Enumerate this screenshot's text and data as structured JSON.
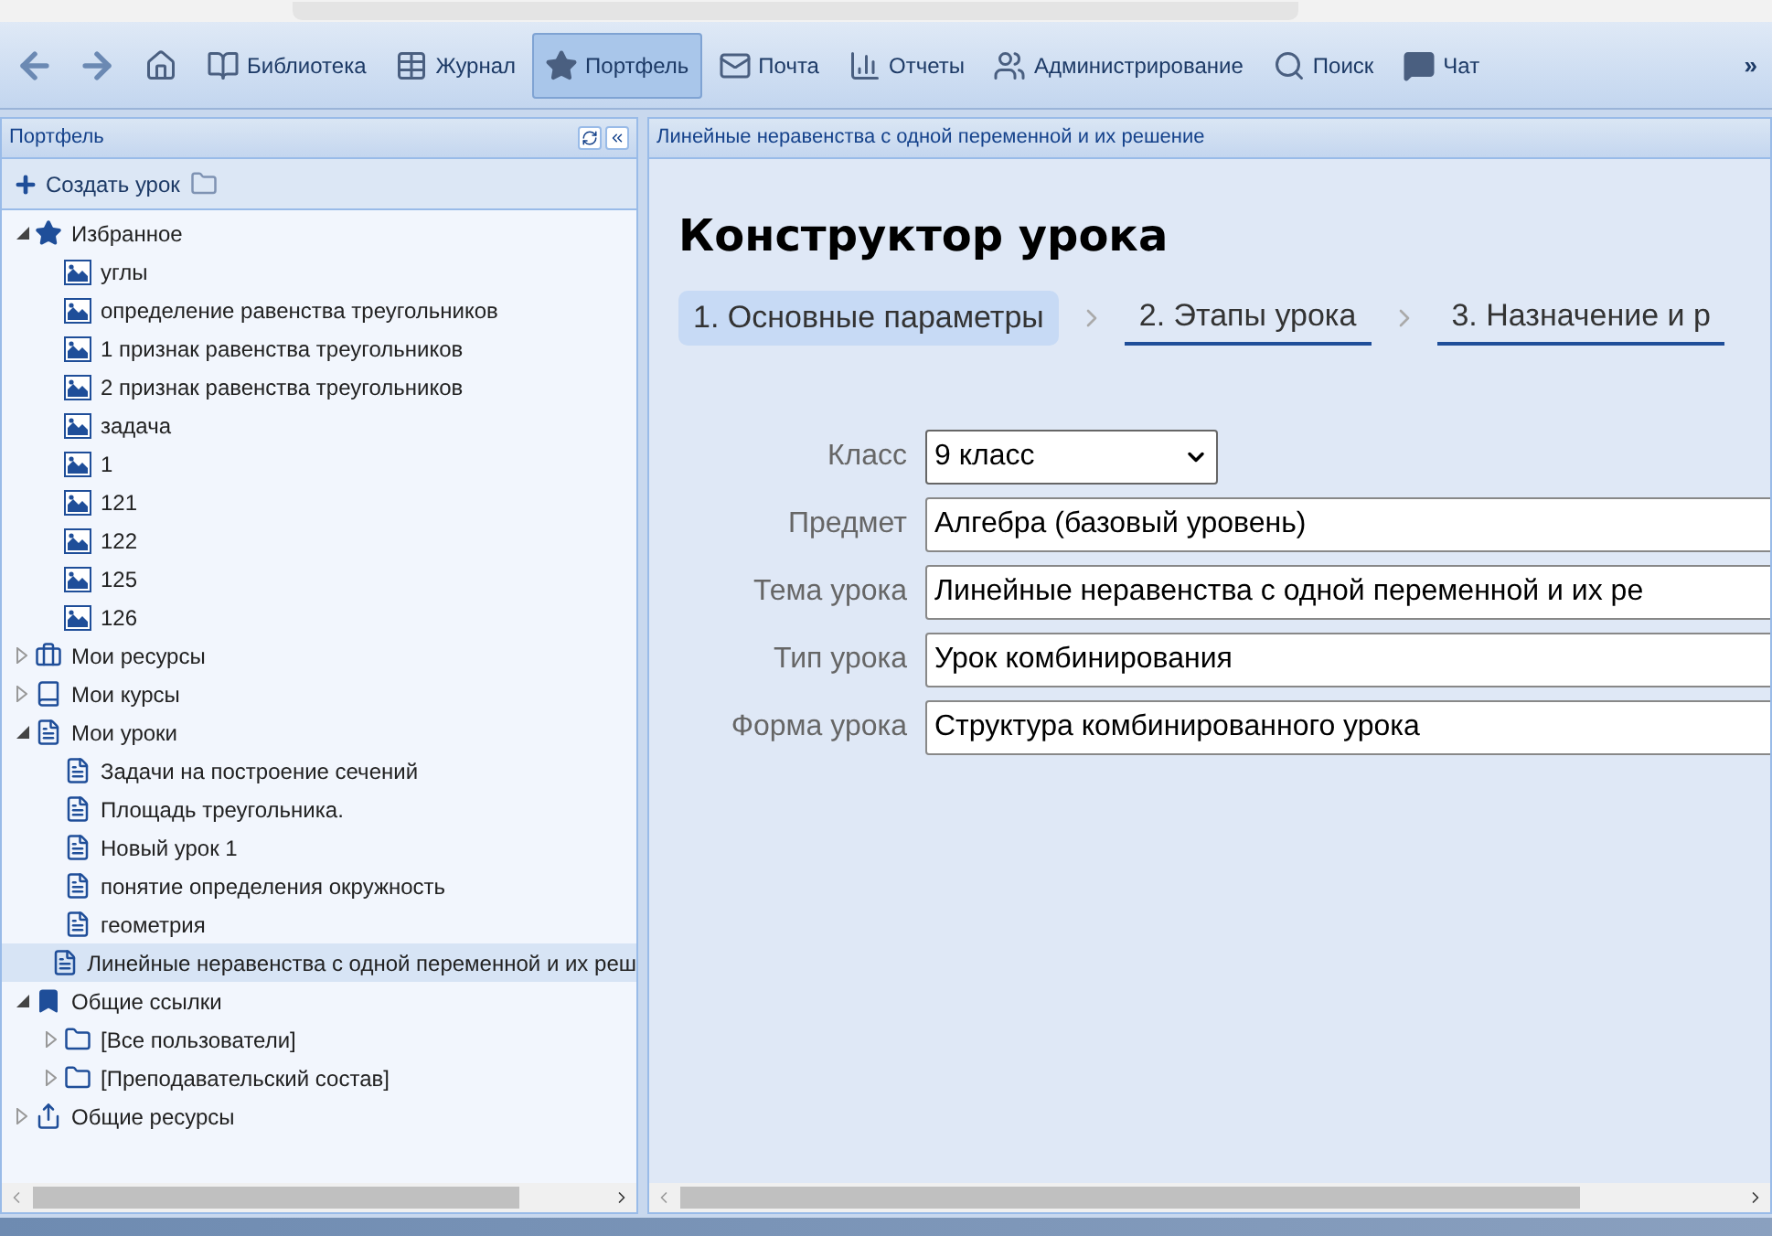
{
  "toolbar": {
    "items": [
      {
        "kind": "home",
        "selected": false
      },
      {
        "kind": "book",
        "label": "Библиотека",
        "selected": false
      },
      {
        "kind": "journal",
        "label": "Журнал",
        "selected": false
      },
      {
        "kind": "star",
        "label": "Портфель",
        "selected": true
      },
      {
        "kind": "mail",
        "label": "Почта",
        "selected": false
      },
      {
        "kind": "chart",
        "label": "Отчеты",
        "selected": false
      },
      {
        "kind": "users",
        "label": "Администрирование",
        "selected": false
      },
      {
        "kind": "search",
        "label": "Поиск",
        "selected": false
      },
      {
        "kind": "chat",
        "label": "Чат",
        "selected": false
      }
    ],
    "more": "»"
  },
  "sidebar": {
    "title": "Портфель",
    "create_label": "Создать урок",
    "tree": [
      {
        "kind": "star",
        "label": "Избранное",
        "expanded": true,
        "selected": false,
        "children": [
          {
            "kind": "image",
            "label": "углы",
            "selected": false
          },
          {
            "kind": "image",
            "label": "определение равенства треугольников",
            "selected": false
          },
          {
            "kind": "image",
            "label": "1 признак равенства треугольников",
            "selected": false
          },
          {
            "kind": "image",
            "label": "2 признак равенства треугольников",
            "selected": false
          },
          {
            "kind": "image",
            "label": "задача",
            "selected": false
          },
          {
            "kind": "image",
            "label": "1",
            "selected": false
          },
          {
            "kind": "image",
            "label": "121",
            "selected": false
          },
          {
            "kind": "image",
            "label": "122",
            "selected": false
          },
          {
            "kind": "image",
            "label": "125",
            "selected": false
          },
          {
            "kind": "image",
            "label": "126",
            "selected": false
          }
        ]
      },
      {
        "kind": "briefcase",
        "label": "Мои ресурсы",
        "expanded": false,
        "selected": false
      },
      {
        "kind": "book",
        "label": "Мои курсы",
        "expanded": false,
        "selected": false
      },
      {
        "kind": "lessons",
        "label": "Мои уроки",
        "expanded": true,
        "selected": false,
        "children": [
          {
            "kind": "lesson",
            "label": "Задачи на построение сечений",
            "selected": false
          },
          {
            "kind": "lesson",
            "label": "Площадь треугольника.",
            "selected": false
          },
          {
            "kind": "lesson",
            "label": "Новый урок 1",
            "selected": false
          },
          {
            "kind": "lesson",
            "label": "понятие определения окружность",
            "selected": false
          },
          {
            "kind": "lesson",
            "label": "геометрия",
            "selected": false
          },
          {
            "kind": "lesson",
            "label": "Линейные неравенства с одной переменной и их реш",
            "selected": true
          }
        ]
      },
      {
        "kind": "bookmark",
        "label": "Общие ссылки",
        "expanded": true,
        "selected": false,
        "children": [
          {
            "kind": "folder",
            "label": "[Все пользователи]",
            "expanded": false,
            "selected": false
          },
          {
            "kind": "folder",
            "label": "[Преподавательский состав]",
            "expanded": false,
            "selected": false
          }
        ]
      },
      {
        "kind": "share",
        "label": "Общие ресурсы",
        "expanded": false,
        "selected": false
      }
    ]
  },
  "main": {
    "tab_title": "Линейные неравенства с одной переменной и их решение",
    "heading": "Конструктор урока",
    "steps": [
      {
        "label": "1. Основные параметры",
        "selected": true
      },
      {
        "label": "2. Этапы урока",
        "selected": false
      },
      {
        "label": "3. Назначение и р",
        "selected": false
      }
    ],
    "fields": [
      {
        "kind": "select",
        "label": "Класс",
        "value": "9 класс"
      },
      {
        "kind": "text",
        "label": "Предмет",
        "value": "Алгебра (базовый уровень)"
      },
      {
        "kind": "text",
        "label": "Тема урока",
        "value": "Линейные неравенства с одной переменной и их ре"
      },
      {
        "kind": "text",
        "label": "Тип урока",
        "value": "Урок комбинирования"
      },
      {
        "kind": "text",
        "label": "Форма урока",
        "value": "Структура комбинированного урока"
      }
    ]
  }
}
